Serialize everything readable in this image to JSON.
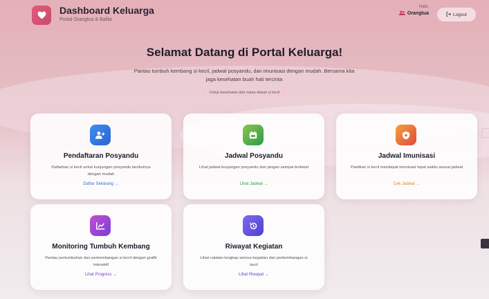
{
  "header": {
    "title": "Dashboard Keluarga",
    "subtitle": "Portal Orangtua & Balita",
    "greeting": "Halo,",
    "user": "Orangtua",
    "logout_label": "Logout"
  },
  "hero": {
    "title": "Selamat Datang di Portal Keluarga!",
    "description": "Pantau tumbuh kembang si kecil, jadwal posyandu, dan imunisasi dengan mudah. Bersama kita jaga kesehatan buah hati tercinta",
    "tagline": "Untuk kesehatan dan masa depan si kecil"
  },
  "cards": [
    {
      "title": "Pendaftaran Posyandu",
      "description": "Daftarkan si kecil untuk kunjungan posyandu berikutnya dengan mudah",
      "link": "Daftar Sekarang",
      "icon": "add-user-icon",
      "color": "#2f6fd6"
    },
    {
      "title": "Jadwal Posyandu",
      "description": "Lihat jadwal kunjungan posyandu dan jangan sampai terlewat",
      "link": "Lihat Jadwal",
      "icon": "calendar-icon",
      "color": "#2e9a4d"
    },
    {
      "title": "Jadwal Imunisasi",
      "description": "Pastikan si kecil mendapat imunisasi tepat waktu sesuai jadwal",
      "link": "Cek Jadwal",
      "icon": "shield-icon",
      "color": "#e0842a"
    },
    {
      "title": "Monitoring Tumbuh Kembang",
      "description": "Pantau pertumbuhan dan perkembangan si kecil dengan grafik interaktif",
      "link": "Lihat Progress",
      "icon": "chart-icon",
      "color": "#7a3fd0"
    },
    {
      "title": "Riwayat Kegiatan",
      "description": "Lihat catatan lengkap semua kegiatan dan perkembangan si kecil",
      "link": "Lihat Riwayat",
      "icon": "history-icon",
      "color": "#5a48d8"
    }
  ]
}
